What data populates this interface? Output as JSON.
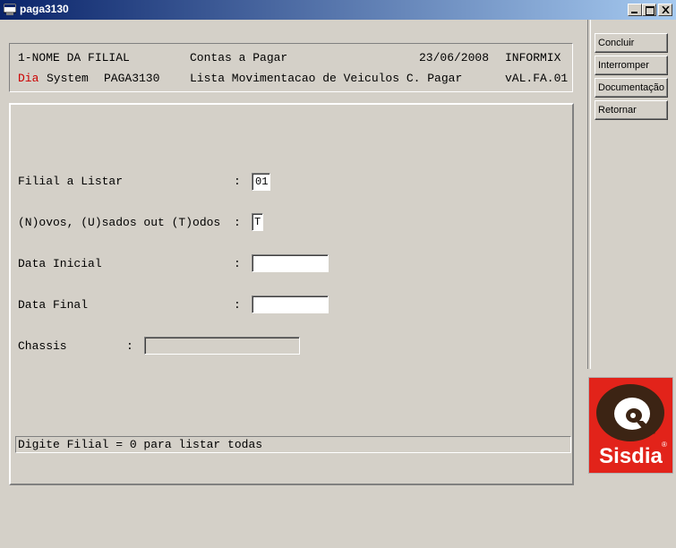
{
  "window": {
    "title": "paga3130"
  },
  "header": {
    "line1": {
      "filial": "1-NOME DA FILIAL",
      "module": "Contas a Pagar",
      "date": "23/06/2008",
      "db": "INFORMIX"
    },
    "line2": {
      "brand_red": "Dia",
      "brand_rest": "System",
      "program": "PAGA3130",
      "report": "Lista Movimentacao de Veiculos C. Pagar",
      "version": "vAL.FA.01"
    }
  },
  "form": {
    "filial": {
      "label": "Filial a Listar",
      "colon": ":",
      "value": "01"
    },
    "tipo": {
      "label": "(N)ovos, (U)sados out (T)odos",
      "colon": ":",
      "value": "T"
    },
    "data_ini": {
      "label": "Data Inicial",
      "colon": ":",
      "value": ""
    },
    "data_fim": {
      "label": "Data Final",
      "colon": ":",
      "value": ""
    },
    "chassis": {
      "label": "Chassis",
      "colon": ":",
      "value": ""
    }
  },
  "status": {
    "message": "Digite Filial = 0 para listar todas"
  },
  "buttons": {
    "concluir": "Concluir",
    "interromper": "Interromper",
    "documentacao": "Documentação",
    "retornar": "Retornar"
  },
  "logo": {
    "text": "Sisdia",
    "reg": "®"
  },
  "colors": {
    "titlebar_start": "#0a246a",
    "titlebar_end": "#a6caf0",
    "brand_red": "#cc0000",
    "logo_red": "#e2231a",
    "logo_brown": "#3c2414"
  }
}
